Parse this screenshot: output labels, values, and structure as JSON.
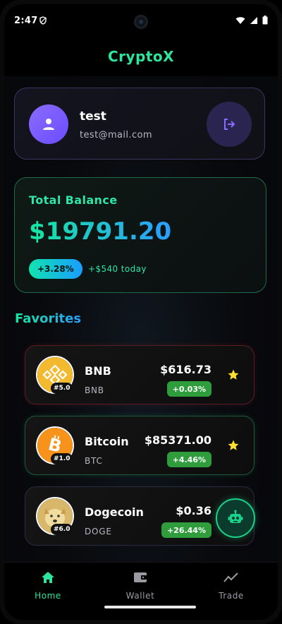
{
  "status": {
    "time": "2:47"
  },
  "app": {
    "title": "CryptoX"
  },
  "profile": {
    "name": "test",
    "email": "test@mail.com"
  },
  "balance": {
    "title": "Total Balance",
    "amount": "$19791.20",
    "change": "+3.28%",
    "today": "+$540 today"
  },
  "favorites": {
    "title": "Favorites",
    "coins": [
      {
        "name": "BNB",
        "symbol": "BNB",
        "rank": "#5.0",
        "price": "$616.73",
        "change": "+0.03%"
      },
      {
        "name": "Bitcoin",
        "symbol": "BTC",
        "rank": "#1.0",
        "price": "$85371.00",
        "change": "+4.46%"
      },
      {
        "name": "Dogecoin",
        "symbol": "DOGE",
        "rank": "#6.0",
        "price": "$0.36",
        "change": "+26.44%"
      }
    ]
  },
  "nav": {
    "home": "Home",
    "wallet": "Wallet",
    "trade": "Trade"
  },
  "colors": {
    "accent": "#2ee59d",
    "purple": "#7a5cff",
    "positive": "#2f9d3c"
  }
}
